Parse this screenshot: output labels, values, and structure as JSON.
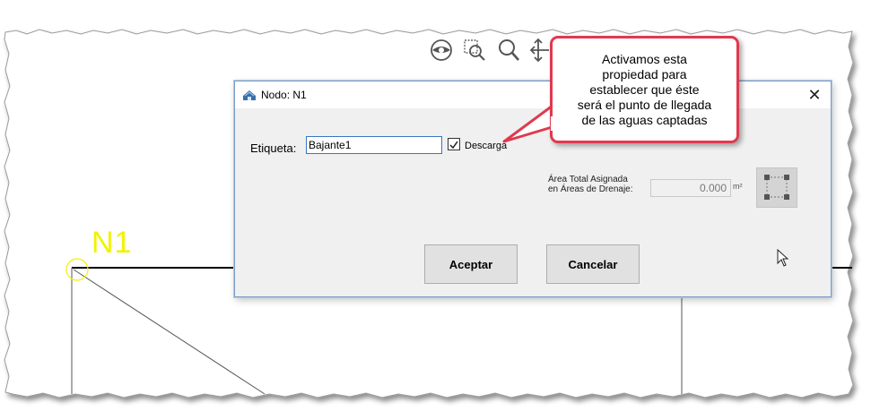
{
  "canvas": {
    "node_label": "N1",
    "node_color": "#f2f200"
  },
  "toolbar": {
    "icons": [
      "eye-icon",
      "zoom-window-icon",
      "magnifier-icon",
      "pan-arrows-icon"
    ]
  },
  "dialog": {
    "title": "Nodo: N1",
    "close_symbol": "✕",
    "etiqueta_label": "Etiqueta:",
    "etiqueta_value": "Bajante1",
    "descarga_checked": true,
    "descarga_label": "Descarga",
    "area_label_line1": "Área Total Asignada",
    "area_label_line2": "en Áreas de Drenaje:",
    "area_value": "0.000",
    "area_unit": "m²",
    "accept_label": "Aceptar",
    "cancel_label": "Cancelar"
  },
  "callout": {
    "lines": [
      "Activamos esta",
      "propiedad para",
      "establecer que éste",
      "será el punto de llegada",
      "de las aguas captadas"
    ],
    "border_color": "#e0394f"
  },
  "colors": {
    "dialog_border": "#7a9cc4",
    "input_focus_border": "#3a76c4"
  }
}
